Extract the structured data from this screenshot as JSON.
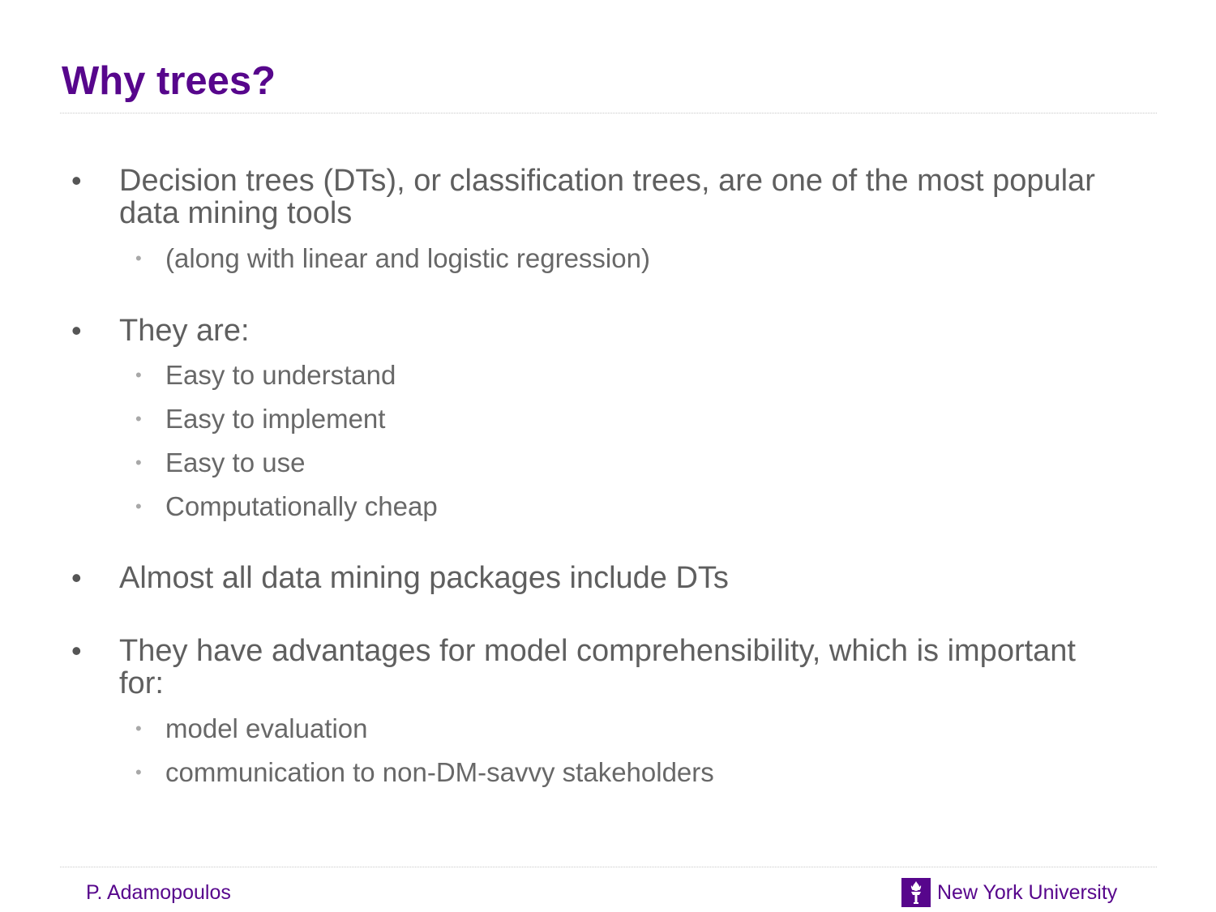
{
  "slide": {
    "title": "Why trees?",
    "bullets": [
      {
        "text": "Decision trees (DTs), or classification trees, are one of the most popular data mining tools",
        "sub": [
          "(along with linear and logistic regression)"
        ]
      },
      {
        "text": "They are:",
        "sub": [
          "Easy to understand",
          "Easy to implement",
          "Easy to use",
          "Computationally cheap"
        ]
      },
      {
        "text": "Almost all data mining packages include DTs",
        "sub": []
      },
      {
        "text": "They have advantages for model comprehensibility, which is important for:",
        "sub": [
          "model evaluation",
          "communication to non-DM-savvy stakeholders"
        ]
      }
    ]
  },
  "footer": {
    "author": "P. Adamopoulos",
    "logo_icon": "torch-icon",
    "university": "New York University"
  },
  "colors": {
    "accent": "#57068c",
    "body_text": "#5f5f5f",
    "sub_bullet": "#a8a8a8"
  }
}
